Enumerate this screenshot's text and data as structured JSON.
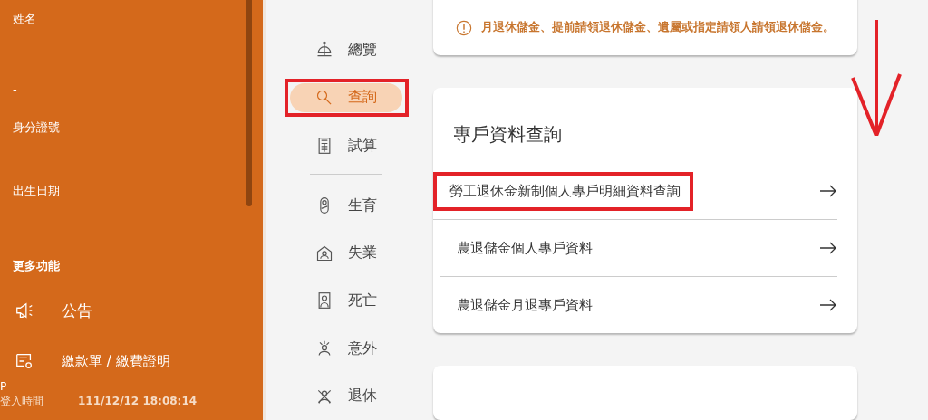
{
  "profile": {
    "fields": [
      {
        "label": "姓名",
        "value": "-"
      },
      {
        "label": "身分證號"
      },
      {
        "label": "出生日期"
      }
    ]
  },
  "more_functions": {
    "title": "更多功能",
    "items": [
      {
        "label": "公告",
        "kind": "megaphone"
      },
      {
        "label": "繳款單 / 繳費證明",
        "kind": "receipt"
      }
    ]
  },
  "login": {
    "ip_label": "P",
    "time_label": "登入時間",
    "time": "111/12/12 18:08:14"
  },
  "nav": [
    {
      "label": "總覽",
      "kind": "overview",
      "selected": false,
      "marked": false
    },
    {
      "label": "查詢",
      "kind": "search",
      "selected": true,
      "marked": true
    },
    {
      "label": "試算",
      "kind": "calculator",
      "selected": false,
      "marked": false
    },
    {
      "kind": "divider"
    },
    {
      "label": "生育",
      "kind": "baby",
      "selected": false,
      "marked": false
    },
    {
      "label": "失業",
      "kind": "house",
      "selected": false,
      "marked": false
    },
    {
      "label": "死亡",
      "kind": "portrait",
      "selected": false,
      "marked": false
    },
    {
      "label": "意外",
      "kind": "accident",
      "selected": false,
      "marked": false
    },
    {
      "label": "退休",
      "kind": "retire",
      "selected": false,
      "marked": false
    }
  ],
  "notice": "月退休儲金、提前請領退休儲金、遺屬或指定請領人請領退休儲金。",
  "account_query": {
    "title": "專戶資料查詢",
    "links": [
      {
        "label": "勞工退休金新制個人專戶明細資料查詢",
        "marked": true
      },
      {
        "label": "農退儲金個人專戶資料",
        "marked": false
      },
      {
        "label": "農退儲金月退專戶資料",
        "marked": false
      }
    ]
  }
}
